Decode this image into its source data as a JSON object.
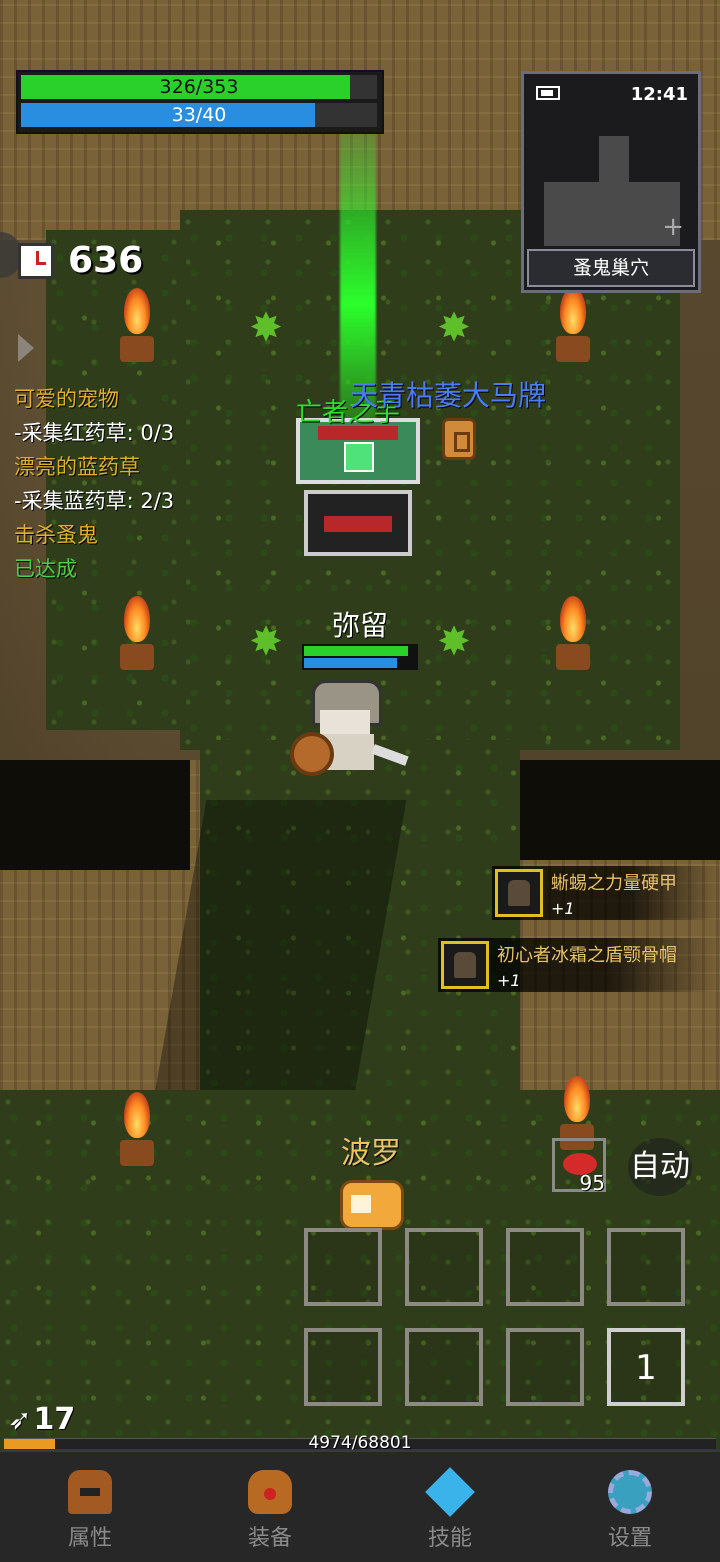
{
  "hud": {
    "hp": {
      "text": "326/353",
      "current": 326,
      "max": 353
    },
    "mp": {
      "text": "33/40",
      "current": 33,
      "max": 40
    }
  },
  "minimap": {
    "time": "12:41",
    "location": "蚤鬼巢穴",
    "icon": "battery-icon"
  },
  "timer": {
    "value": "636",
    "icon": "clock-icon"
  },
  "quests": [
    {
      "title": "可爱的宠物",
      "detail": "-采集红药草: 0/3"
    },
    {
      "title": "漂亮的蓝药草",
      "detail": "-采集蓝药草: 2/3"
    },
    {
      "title": "击杀蚤鬼",
      "detail": "已达成"
    }
  ],
  "loot_labels": {
    "green": "亡者之手",
    "blue": "天青枯萎大马牌"
  },
  "player": {
    "name": "弥留",
    "hp_fraction": 0.93,
    "mp_fraction": 0.83
  },
  "pet": {
    "name": "波罗"
  },
  "notifications": [
    {
      "name": "蜥蜴之力量硬甲",
      "qty": "+1"
    },
    {
      "name": "初心者冰霜之盾颚骨帽",
      "qty": "+1"
    }
  ],
  "consumable": {
    "count": "95",
    "icon": "meat-icon"
  },
  "auto_label": "自动",
  "skill_page": "1",
  "level": "17",
  "xp": {
    "text": "4974/68801",
    "current": 4974,
    "max": 68801
  },
  "nav": [
    {
      "label": "属性",
      "icon": "helmet-icon"
    },
    {
      "label": "装备",
      "icon": "bag-icon"
    },
    {
      "label": "技能",
      "icon": "crystal-icon"
    },
    {
      "label": "设置",
      "icon": "gear-icon"
    }
  ],
  "colors": {
    "hp": "#2bd12b",
    "mp": "#2a8ee0",
    "quest_title": "#e0b030",
    "quest_done": "#4ad14a",
    "xp": "#e89a22"
  }
}
